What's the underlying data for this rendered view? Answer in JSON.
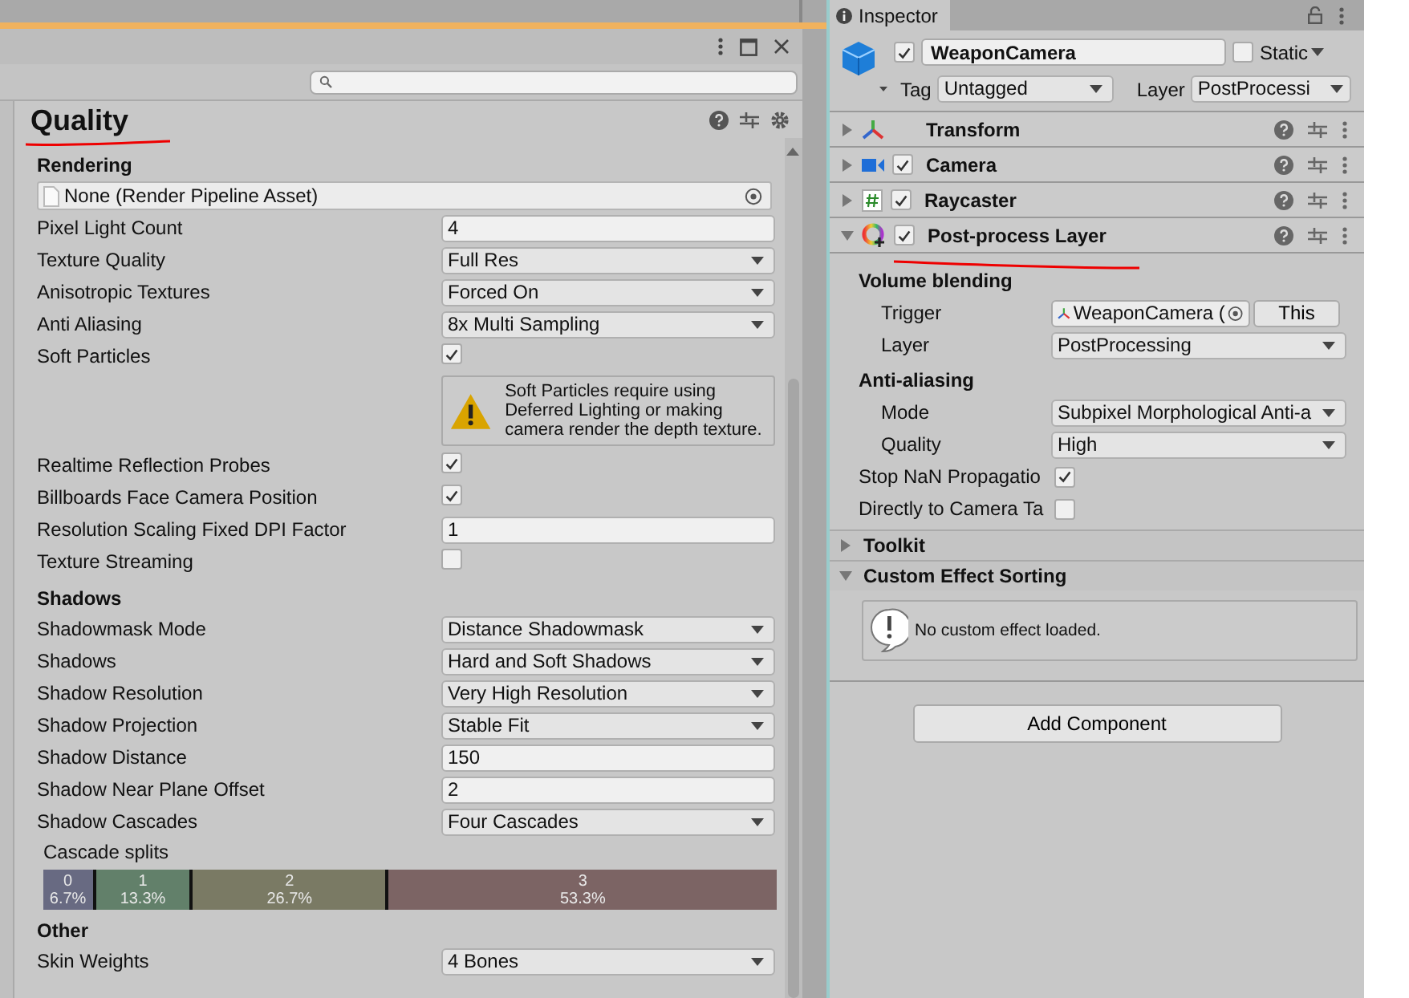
{
  "quality": {
    "title": "Quality",
    "settings": [
      {
        "kind": "heading",
        "label": "Rendering"
      },
      {
        "kind": "object",
        "value": "None (Render Pipeline Asset)"
      },
      {
        "kind": "field",
        "label": "Pixel Light Count",
        "value": "4"
      },
      {
        "kind": "dropdown",
        "label": "Texture Quality",
        "value": "Full Res"
      },
      {
        "kind": "dropdown",
        "label": "Anisotropic Textures",
        "value": "Forced On"
      },
      {
        "kind": "dropdown",
        "label": "Anti Aliasing",
        "value": "8x Multi Sampling"
      },
      {
        "kind": "checkbox",
        "label": "Soft Particles",
        "checked": true
      },
      {
        "kind": "warning",
        "text": "Soft Particles require using Deferred Lighting or making camera render the depth texture."
      },
      {
        "kind": "checkbox",
        "label": "Realtime Reflection Probes",
        "checked": true
      },
      {
        "kind": "checkbox",
        "label": "Billboards Face Camera Position",
        "checked": true
      },
      {
        "kind": "field",
        "label": "Resolution Scaling Fixed DPI Factor",
        "value": "1"
      },
      {
        "kind": "checkbox",
        "label": "Texture Streaming",
        "checked": false
      },
      {
        "kind": "heading",
        "label": "Shadows"
      },
      {
        "kind": "dropdown",
        "label": "Shadowmask Mode",
        "value": "Distance Shadowmask"
      },
      {
        "kind": "dropdown",
        "label": "Shadows",
        "value": "Hard and Soft Shadows"
      },
      {
        "kind": "dropdown",
        "label": "Shadow Resolution",
        "value": "Very High Resolution"
      },
      {
        "kind": "dropdown",
        "label": "Shadow Projection",
        "value": "Stable Fit"
      },
      {
        "kind": "field",
        "label": "Shadow Distance",
        "value": "150"
      },
      {
        "kind": "field",
        "label": "Shadow Near Plane Offset",
        "value": "2"
      },
      {
        "kind": "dropdown",
        "label": "Shadow Cascades",
        "value": "Four Cascades"
      },
      {
        "kind": "cascades",
        "label": "Cascade splits",
        "splits": [
          {
            "index": "0",
            "percent": "6.7%",
            "level": 0.067,
            "color": "#686a82"
          },
          {
            "index": "1",
            "percent": "13.3%",
            "level": 0.133,
            "color": "#62806a"
          },
          {
            "index": "2",
            "percent": "26.7%",
            "level": 0.267,
            "color": "#7a7a64"
          },
          {
            "index": "3",
            "percent": "53.3%",
            "level": 0.533,
            "color": "#7c6464"
          }
        ]
      },
      {
        "kind": "heading",
        "label": "Other"
      },
      {
        "kind": "dropdown",
        "label": "Skin Weights",
        "value": "4 Bones"
      }
    ]
  },
  "inspector": {
    "tab": "Inspector",
    "object_name": "WeaponCamera",
    "active": true,
    "static_label": "Static",
    "static": false,
    "tag_label": "Tag",
    "tag": "Untagged",
    "layer_label": "Layer",
    "layer": "PostProcessi",
    "components": [
      {
        "kind": "transform",
        "name": "Transform",
        "expanded": false
      },
      {
        "kind": "camera",
        "name": "Camera",
        "expanded": false,
        "enabled": true
      },
      {
        "kind": "script",
        "name": "Raycaster",
        "expanded": false,
        "enabled": true
      },
      {
        "kind": "postprocess",
        "name": "Post-process Layer",
        "expanded": true,
        "enabled": true
      }
    ],
    "fields": [
      {
        "kind": "heading",
        "label": "Volume blending"
      },
      {
        "kind": "object",
        "label": "Trigger",
        "value": "WeaponCamera (",
        "button": "This"
      },
      {
        "kind": "dropdown",
        "label": "Layer",
        "value": "PostProcessing"
      },
      {
        "kind": "heading",
        "label": "Anti-aliasing"
      },
      {
        "kind": "dropdown",
        "label": "Mode",
        "value": "Subpixel Morphological Anti-a"
      },
      {
        "kind": "dropdown",
        "label": "Quality",
        "value": "High"
      },
      {
        "kind": "checkbox",
        "label": "Stop NaN Propagatio",
        "checked": true
      },
      {
        "kind": "checkbox",
        "label": "Directly to Camera Ta",
        "checked": false
      }
    ],
    "foldouts": [
      {
        "label": "Toolkit",
        "expanded": false
      },
      {
        "label": "Custom Effect Sorting",
        "expanded": true
      }
    ],
    "info": "No custom effect loaded.",
    "add_button": "Add Component"
  }
}
